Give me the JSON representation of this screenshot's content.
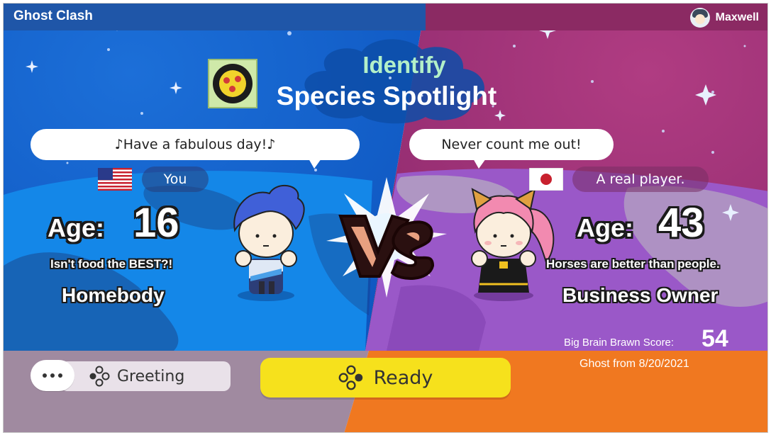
{
  "app": {
    "title": "Ghost Clash"
  },
  "user": {
    "name": "Maxwell",
    "avatar_icon": "player-avatar-icon"
  },
  "mode": {
    "subtitle": "Identify",
    "title": "Species Spotlight",
    "badge_icon": "species-spotlight-badge-icon"
  },
  "player_left": {
    "greeting": "♪Have a fabulous day!♪",
    "flag": "us-flag-icon",
    "nickname": "You",
    "age_label": "Age:",
    "age": "16",
    "catchphrase": "Isn't food the BEST?!",
    "title": "Homebody",
    "panel_color": "#1565d6"
  },
  "player_right": {
    "greeting": "Never count me out!",
    "flag": "japan-flag-icon",
    "nickname": "A real player.",
    "age_label": "Age:",
    "age": "43",
    "catchphrase": "Horses are better than people.",
    "title": "Business Owner",
    "score_label": "Big Brain Brawn Score:",
    "score": "54",
    "ghost_date": "Ghost from 8/20/2021",
    "panel_color": "#9a3a8a"
  },
  "versus": {
    "label": "VS"
  },
  "buttons": {
    "greeting_label": "Greeting",
    "ready_label": "Ready",
    "button_icon": "controller-buttons-icon"
  },
  "colors": {
    "ready_yellow": "#f6e11c",
    "left_blue": "#1565d6",
    "right_magenta": "#9a3a8a",
    "bottom_orange": "#f07820"
  }
}
